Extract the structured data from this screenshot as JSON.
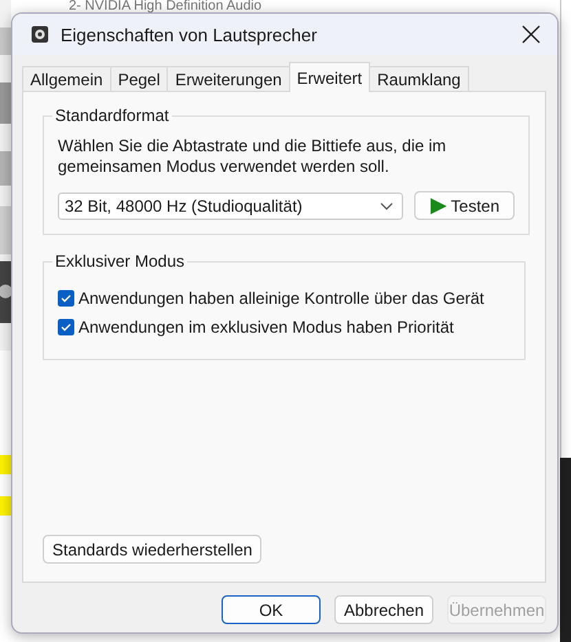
{
  "background": {
    "top_line": "2- NVIDIA High Definition Audio"
  },
  "window": {
    "title": "Eigenschaften von Lautsprecher"
  },
  "tabs": [
    {
      "label": "Allgemein",
      "selected": false
    },
    {
      "label": "Pegel",
      "selected": false
    },
    {
      "label": "Erweiterungen",
      "selected": false
    },
    {
      "label": "Erweitert",
      "selected": true
    },
    {
      "label": "Raumklang",
      "selected": false
    }
  ],
  "standard_format": {
    "heading": "Standardformat",
    "description": "Wählen Sie die Abtastrate und die Bittiefe aus, die im gemeinsamen Modus verwendet werden soll.",
    "format_select": {
      "value": "32 Bit, 48000 Hz (Studioqualität)"
    },
    "test_button": "Testen"
  },
  "exclusive_mode": {
    "heading": "Exklusiver Modus",
    "options": [
      {
        "label": "Anwendungen haben alleinige Kontrolle über das Gerät",
        "checked": true
      },
      {
        "label": "Anwendungen im exklusiven Modus haben Priorität",
        "checked": true
      }
    ]
  },
  "restore_button": "Standards wiederherstellen",
  "buttons": [
    {
      "label": "OK",
      "default": true,
      "disabled": false
    },
    {
      "label": "Abbrechen",
      "default": false,
      "disabled": false
    },
    {
      "label": "Übernehmen",
      "default": false,
      "disabled": true
    }
  ]
}
